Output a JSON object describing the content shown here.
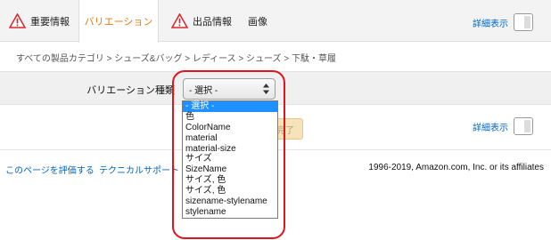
{
  "tabs": {
    "important": "重要情報",
    "variation": "バリエーション",
    "offer": "出品情報",
    "images": "画像"
  },
  "detail_label": "詳細表示",
  "breadcrumb": "すべての製品カテゴリ > シューズ&バッグ > レディース > シューズ > 下駄・草履",
  "variation": {
    "label": "バリエーション種類",
    "selected": "- 選択 -",
    "options": [
      "- 選択 -",
      "色",
      "ColorName",
      "material",
      "material-size",
      "サイズ",
      "SizeName",
      "サイズ, 色",
      "サイズ, 色",
      "sizename-stylename",
      "stylename"
    ]
  },
  "finish_button_label": "完了",
  "footer": {
    "rate_page": "このページを評価する",
    "tech_support": "テクニカルサポート",
    "copyright": "1996-2019, Amazon.com, Inc. or its affiliates"
  },
  "colors": {
    "active_tab": "#e47911",
    "link": "#0066c0",
    "highlight": "#e0141e",
    "selected_option": "#1e90ff"
  }
}
